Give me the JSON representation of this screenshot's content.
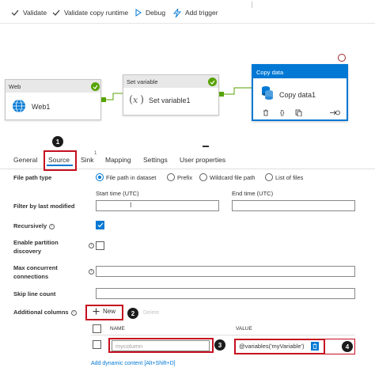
{
  "toolbar": {
    "validate": "Validate",
    "validate_copy_runtime": "Validate copy runtime",
    "debug": "Debug",
    "add_trigger": "Add trigger"
  },
  "canvas": {
    "web_activity": {
      "type": "Web",
      "name": "Web1"
    },
    "setvar_activity": {
      "type": "Set variable",
      "name": "Set variable1"
    },
    "copy_activity": {
      "type": "Copy data",
      "name": "Copy data1"
    }
  },
  "tabs": {
    "general": "General",
    "source": "Source",
    "sink": "Sink",
    "sink_sup": "1",
    "mapping": "Mapping",
    "settings": "Settings",
    "user_properties": "User properties"
  },
  "form": {
    "file_path_type": "File path type",
    "radio_options": [
      "File path in dataset",
      "Prefix",
      "Wildcard file path",
      "List of files"
    ],
    "selected_radio": "File path in dataset",
    "filter_by_last_modified": "Filter by last modified",
    "start_time": "Start time (UTC)",
    "end_time": "End time (UTC)",
    "recursively": "Recursively",
    "recursively_checked": true,
    "enable_partition": "Enable partition",
    "discovery": "discovery",
    "max_concurrent": "Max concurrent",
    "connections": "connections",
    "skip_line_count": "Skip line count",
    "additional_columns": "Additional columns",
    "new": "New",
    "delete": "Delete",
    "col_name_header": "NAME",
    "col_value_header": "VALUE",
    "column_name_value": "mycolumn",
    "column_value": "@variables('myVariable')",
    "add_dynamic_content": "Add dynamic content [Alt+Shift+D]"
  },
  "steps": [
    "1",
    "2",
    "3",
    "4"
  ],
  "colors": {
    "accent": "#0078d4",
    "success": "#57a300",
    "highlight": "#c50f1f"
  }
}
